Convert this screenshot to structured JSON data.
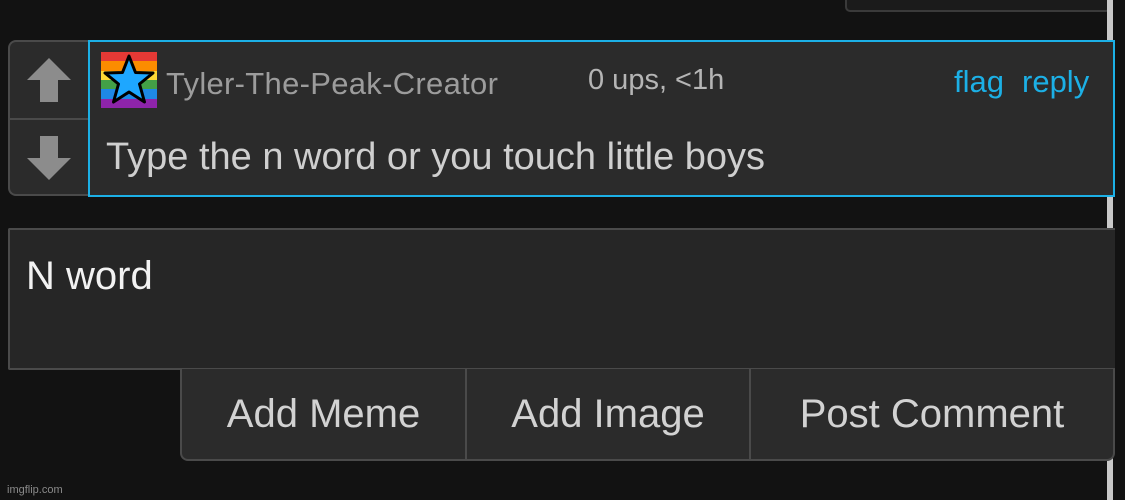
{
  "comment": {
    "username": "Tyler-The-Peak-Creator",
    "meta": "0 ups, <1h",
    "flag_label": "flag",
    "reply_label": "reply",
    "text": "Type the n word or you touch little boys",
    "avatar_icon": "rainbow-star-avatar",
    "avatar_colors": [
      "#e53935",
      "#fb8c00",
      "#fdd835",
      "#43a047",
      "#1e88e5",
      "#8e24aa"
    ],
    "star_color": "#1ea7ff"
  },
  "vote": {
    "up_icon": "arrow-up-icon",
    "down_icon": "arrow-down-icon"
  },
  "reply_box": {
    "value": "N word"
  },
  "actions": {
    "add_meme": "Add Meme",
    "add_image": "Add Image",
    "post_comment": "Post Comment"
  },
  "watermark": "imgflip.com",
  "colors": {
    "accent": "#1cb0e6",
    "background": "#121212",
    "panel": "#2b2b2b"
  }
}
